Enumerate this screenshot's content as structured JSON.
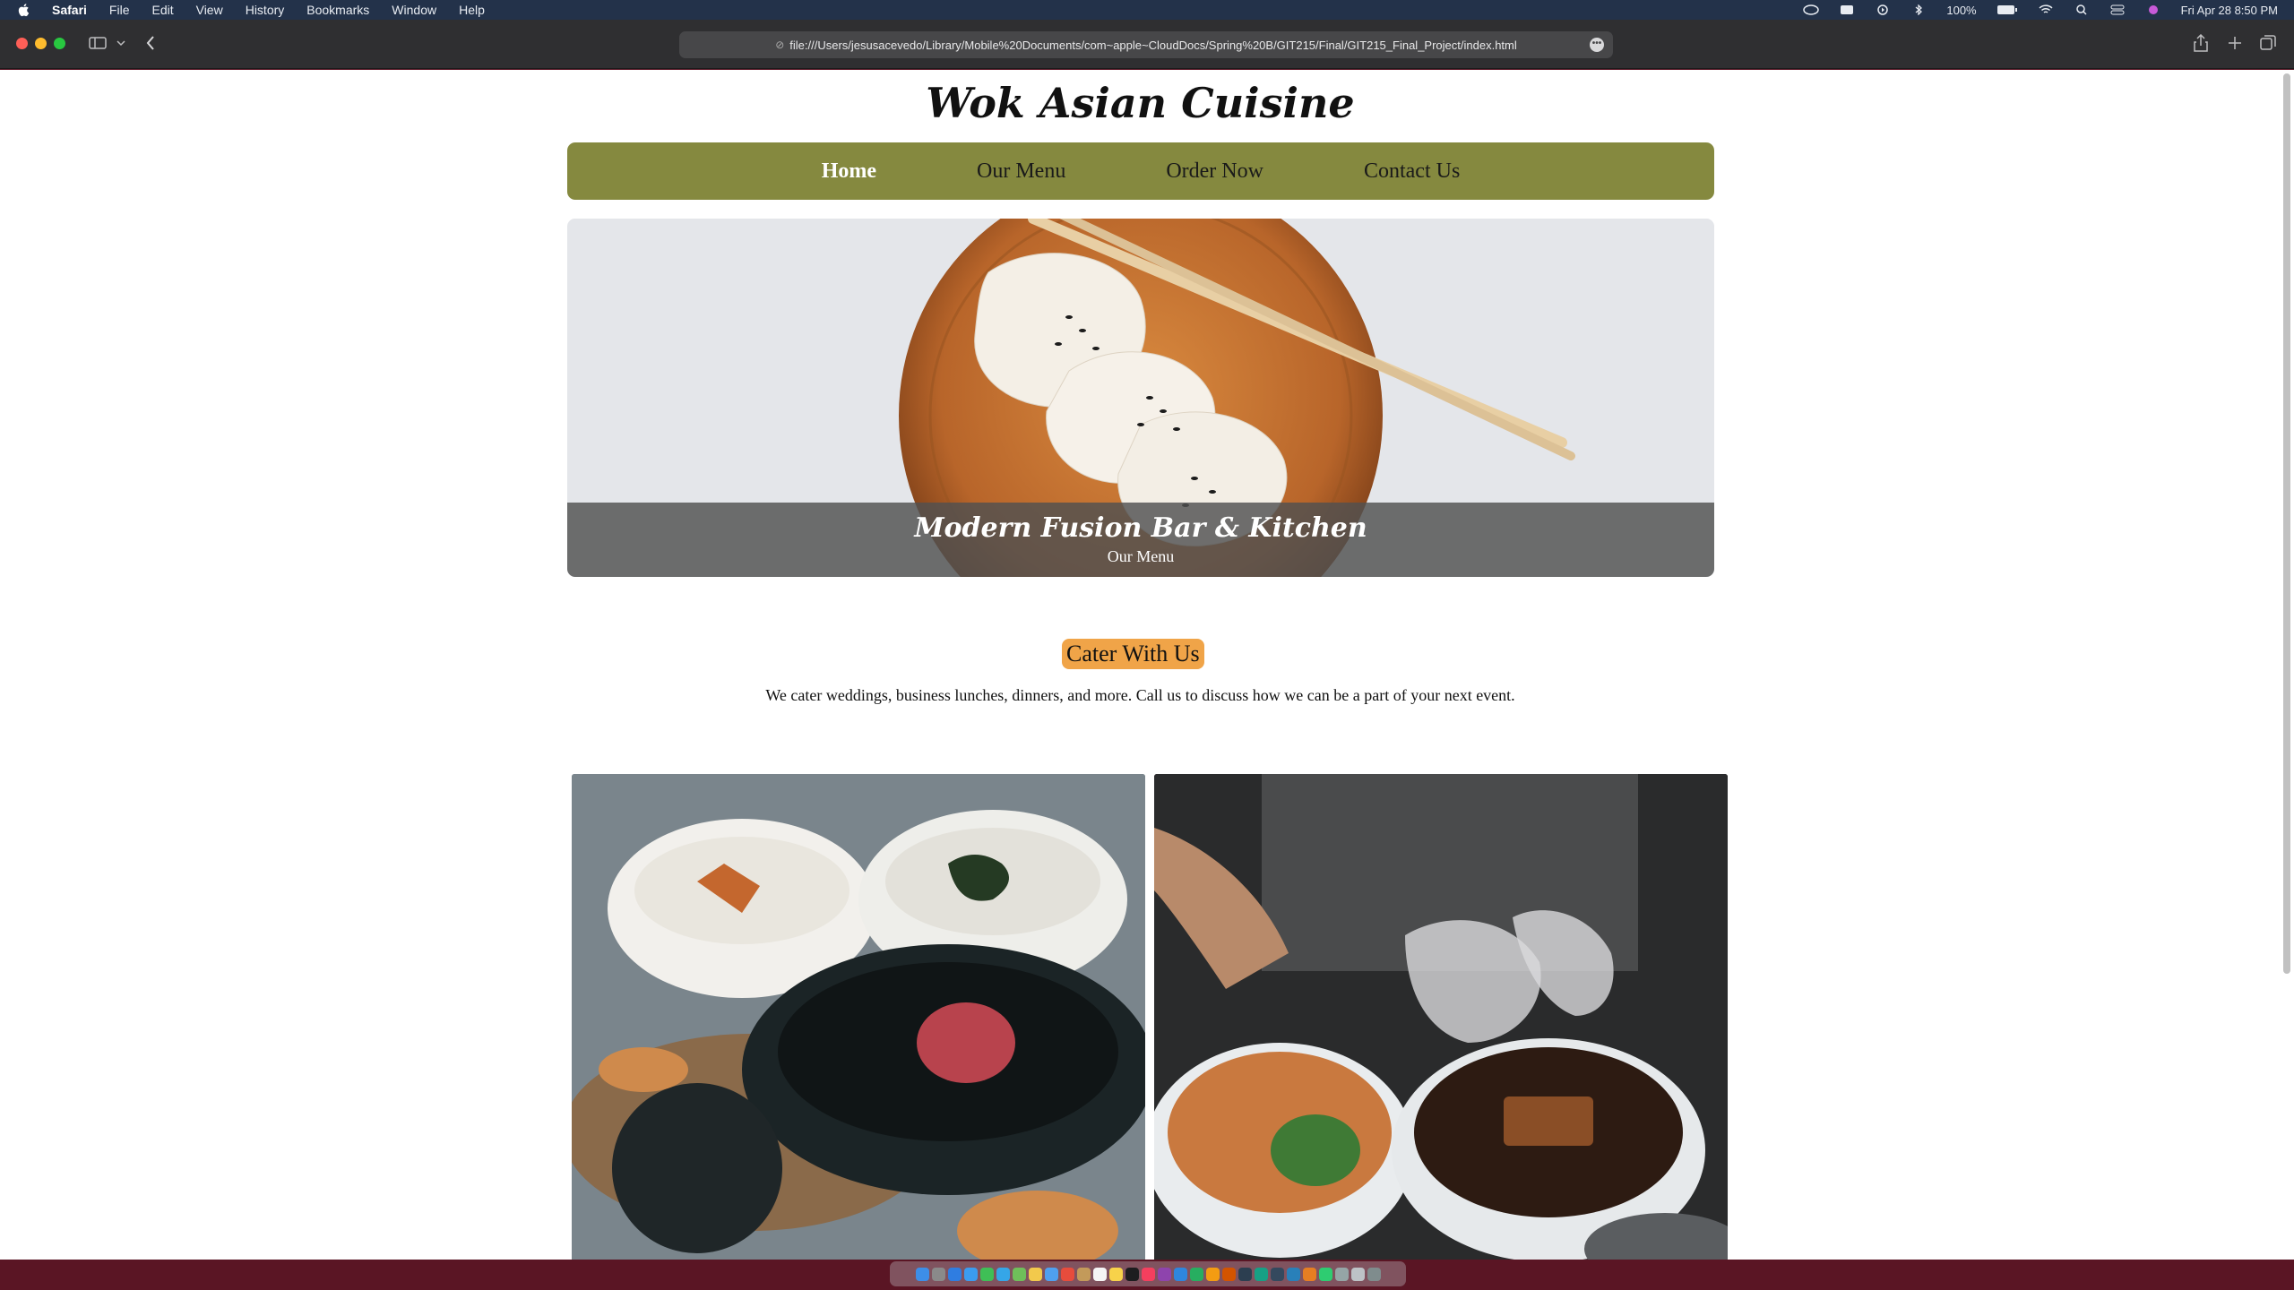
{
  "menubar": {
    "app": "Safari",
    "items": [
      "File",
      "Edit",
      "View",
      "History",
      "Bookmarks",
      "Window",
      "Help"
    ],
    "battery": "100%",
    "datetime": "Fri Apr 28  8:50 PM"
  },
  "browser": {
    "url": "file:///Users/jesusacevedo/Library/Mobile%20Documents/com~apple~CloudDocs/Spring%20B/GIT215/Final/GIT215_Final_Project/index.html"
  },
  "site": {
    "title": "Wok Asian Cuisine",
    "nav": [
      "Home",
      "Our Menu",
      "Order Now",
      "Contact Us"
    ],
    "hero": {
      "title": "Modern Fusion Bar & Kitchen",
      "link": "Our Menu"
    },
    "cater": {
      "heading": "Cater With Us",
      "text": "We cater weddings, business lunches, dinners, and more. Call us to discuss how we can be a part of your next event."
    }
  },
  "colors": {
    "nav_bg": "#85893f",
    "cater_bg": "#f0a448",
    "desktop": "#5a1524"
  }
}
